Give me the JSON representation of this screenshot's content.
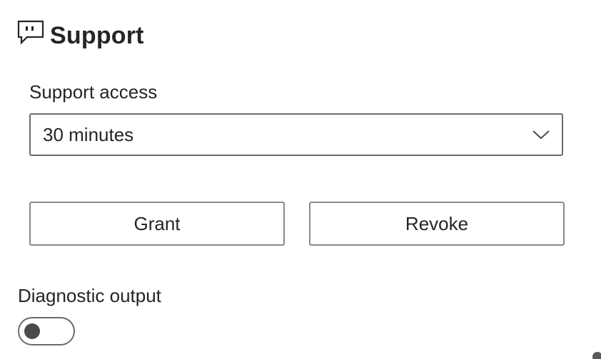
{
  "header": {
    "title": "Support",
    "icon": "chat-bubble-icon"
  },
  "support_access": {
    "label": "Support access",
    "selected_value": "30 minutes",
    "dropdown_icon": "chevron-down-icon"
  },
  "buttons": {
    "grant_label": "Grant",
    "revoke_label": "Revoke"
  },
  "diagnostic_output": {
    "label": "Diagnostic output",
    "enabled": false
  },
  "colors": {
    "text": "#252525",
    "border": "#6b6b6b",
    "knob": "#4a4a4a",
    "background": "#ffffff"
  }
}
